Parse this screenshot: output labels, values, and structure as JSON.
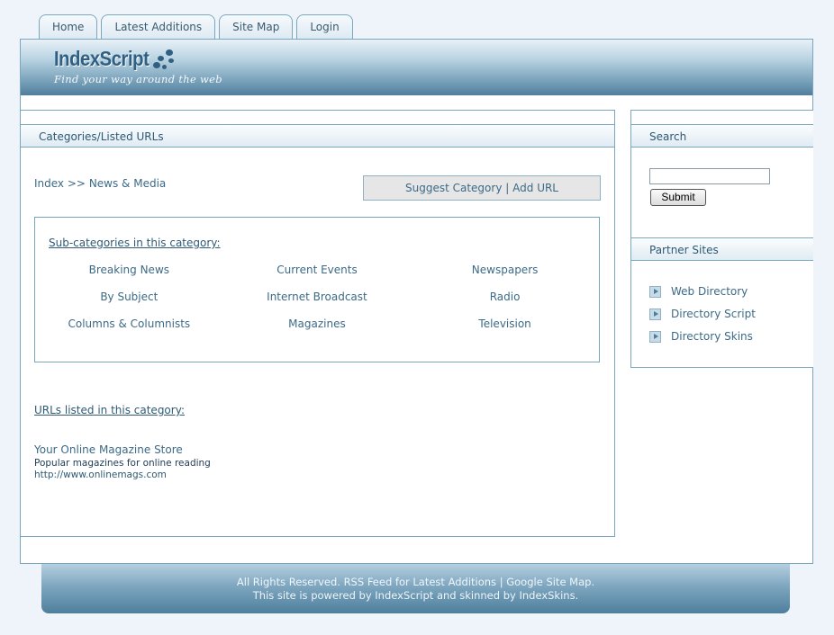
{
  "tabs": [
    "Home",
    "Latest Additions",
    "Site Map",
    "Login"
  ],
  "logo": {
    "title": "IndexScript",
    "tagline": "Find your way around the web"
  },
  "main": {
    "heading": "Categories/Listed URLs",
    "breadcrumb": {
      "root": "Index",
      "sep": ">>",
      "current": "News & Media"
    },
    "suggest": {
      "category": "Suggest Category",
      "sep": "|",
      "add_url": "Add URL"
    },
    "subcategories": {
      "heading": "Sub-categories in this category:",
      "rows": [
        [
          "Breaking News",
          "Current Events",
          "Newspapers"
        ],
        [
          "By Subject",
          "Internet Broadcast",
          "Radio"
        ],
        [
          "Columns & Columnists",
          "Magazines",
          "Television"
        ]
      ]
    },
    "urls": {
      "heading": "URLs listed in this category:",
      "items": [
        {
          "title": "Your Online Magazine Store",
          "description": "Popular magazines for online reading",
          "url": "http://www.onlinemags.com"
        }
      ]
    }
  },
  "sidebar": {
    "search": {
      "heading": "Search",
      "value": "",
      "button": "Submit"
    },
    "partners": {
      "heading": "Partner Sites",
      "items": [
        "Web Directory",
        "Directory Script",
        "Directory Skins"
      ]
    }
  },
  "footer": {
    "line1": "All Rights Reserved. RSS Feed for Latest Additions | Google Site Map.",
    "line2": "This site is powered by IndexScript and skinned by IndexSkins."
  }
}
